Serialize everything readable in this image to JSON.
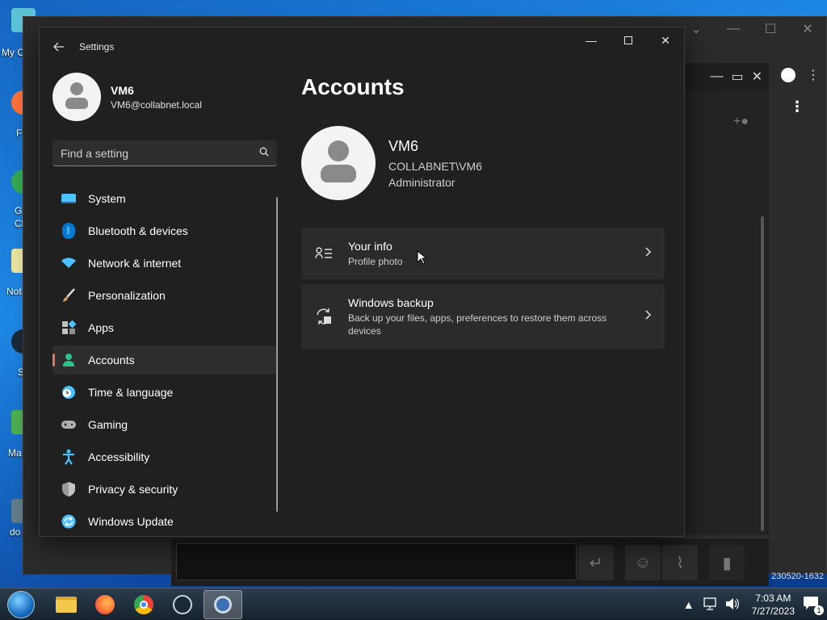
{
  "settings": {
    "window_title": "Settings",
    "profile": {
      "name": "VM6",
      "email": "VM6@collabnet.local"
    },
    "search": {
      "placeholder": "Find a setting"
    },
    "nav": [
      {
        "label": "System",
        "icon": "system-icon",
        "color": "#4cc2ff"
      },
      {
        "label": "Bluetooth & devices",
        "icon": "bluetooth-icon",
        "color": "#0078d4"
      },
      {
        "label": "Network & internet",
        "icon": "wifi-icon",
        "color": "#4cc2ff"
      },
      {
        "label": "Personalization",
        "icon": "brush-icon",
        "color": "#e3a35b"
      },
      {
        "label": "Apps",
        "icon": "apps-icon",
        "color": "#a0a0a0"
      },
      {
        "label": "Accounts",
        "icon": "person-icon",
        "color": "#2bc48a",
        "active": true
      },
      {
        "label": "Time & language",
        "icon": "clock-globe-icon",
        "color": "#4cc2ff"
      },
      {
        "label": "Gaming",
        "icon": "gamepad-icon",
        "color": "#b0b0b0"
      },
      {
        "label": "Accessibility",
        "icon": "accessibility-icon",
        "color": "#4cc2ff"
      },
      {
        "label": "Privacy & security",
        "icon": "shield-icon",
        "color": "#9a9a9a"
      },
      {
        "label": "Windows Update",
        "icon": "update-icon",
        "color": "#4cc2ff"
      }
    ],
    "main": {
      "title": "Accounts",
      "account": {
        "name": "VM6",
        "domain": "COLLABNET\\VM6",
        "role": "Administrator"
      },
      "cards": [
        {
          "title": "Your info",
          "desc": "Profile photo",
          "icon": "person-list-icon"
        },
        {
          "title": "Windows backup",
          "desc": "Back up your files, apps, preferences to restore them across devices",
          "icon": "backup-sync-icon"
        }
      ]
    }
  },
  "background": {
    "version_text": "230520-1632",
    "desktop_icon_labels": [
      "My C",
      "F",
      "G",
      "Cl",
      "Not",
      "S",
      "Ma",
      "do"
    ]
  },
  "taskbar": {
    "apps": [
      {
        "name": "file-explorer-icon"
      },
      {
        "name": "firefox-icon"
      },
      {
        "name": "chrome-icon"
      },
      {
        "name": "steam-icon"
      },
      {
        "name": "settings-gear-icon",
        "active": true
      }
    ],
    "time": "7:03 AM",
    "date": "7/27/2023",
    "notification_count": "1"
  },
  "colors": {
    "accent": "#e8735a",
    "window_bg": "#202020",
    "card_bg": "#2b2b2b"
  }
}
